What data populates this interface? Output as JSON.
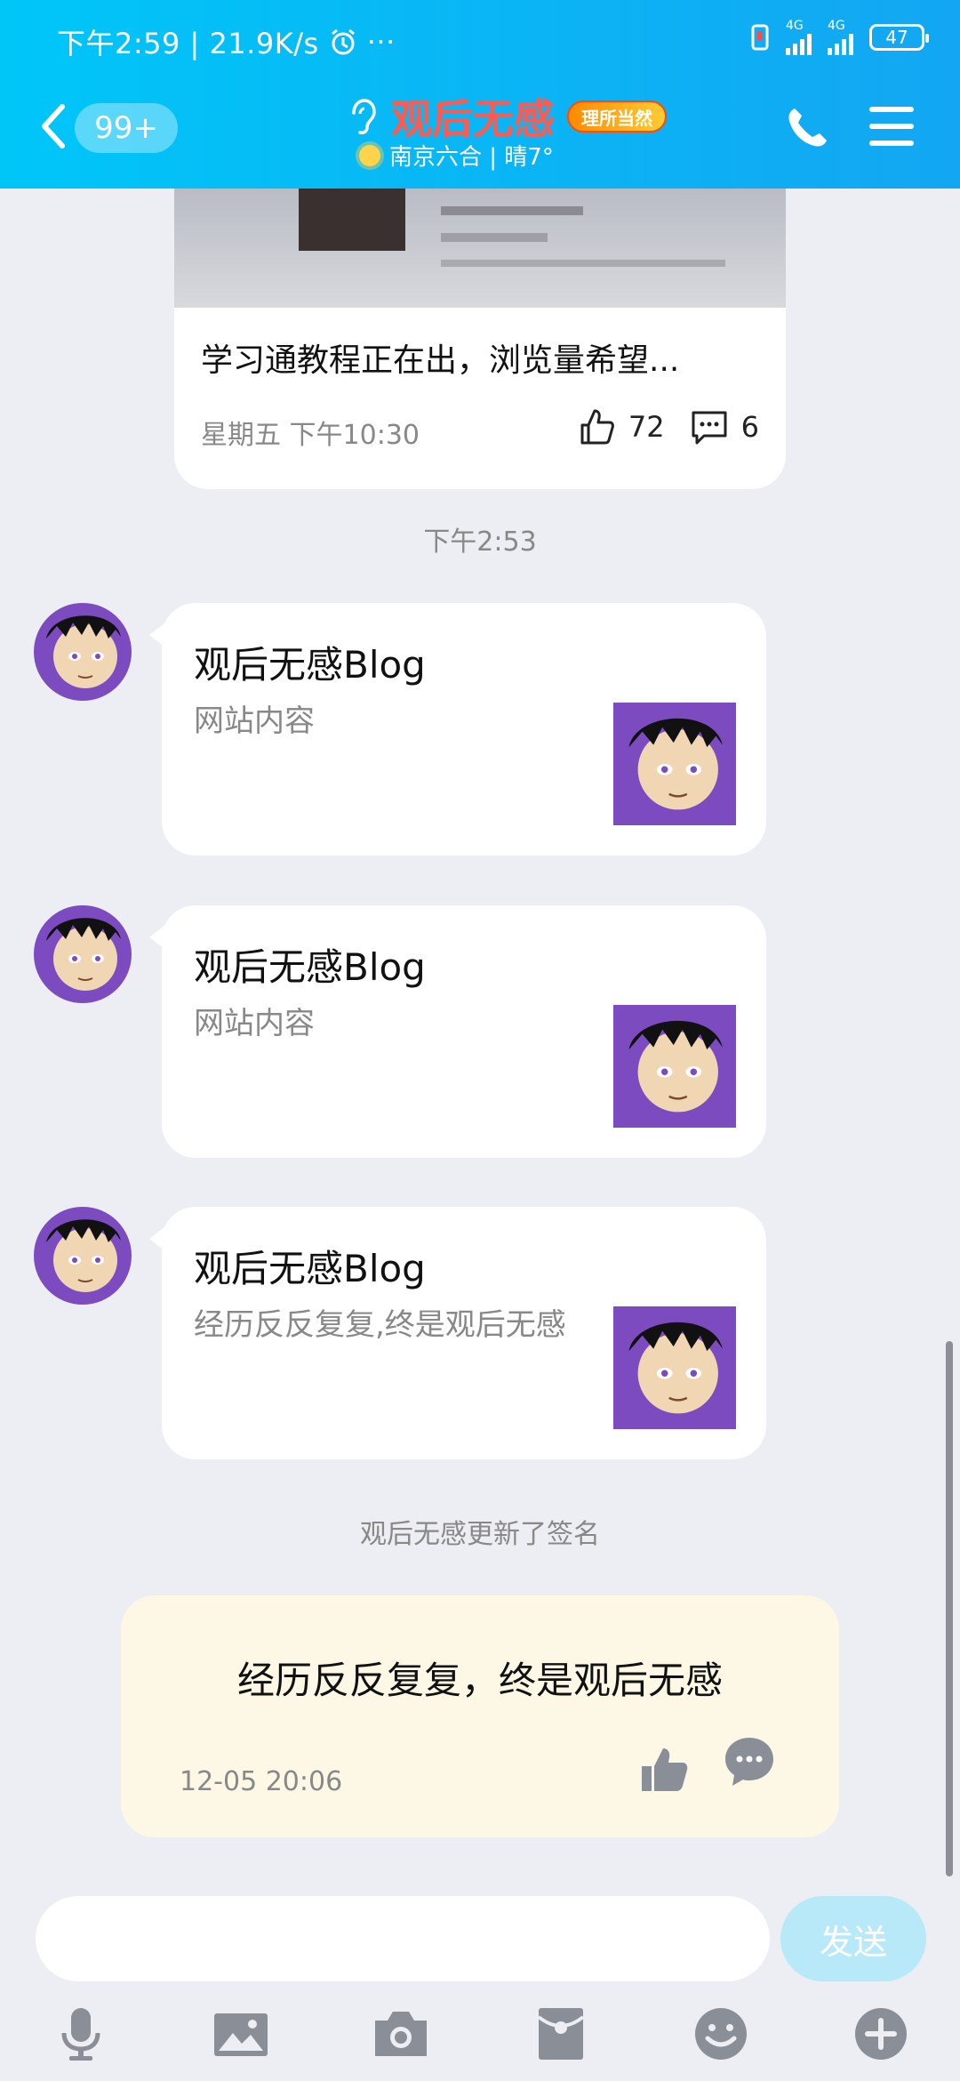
{
  "status_bar": {
    "time_speed": "下午2:59 | 21.9K/s",
    "more": "···",
    "net1": "4G",
    "net2": "4G",
    "battery": "47"
  },
  "header": {
    "badge": "99+",
    "title": "观后无感",
    "vip_badge": "理所当然",
    "subtitle": "南京六合 | 晴7°"
  },
  "shared_post": {
    "title": "学习通教程正在出，浏览量希望...",
    "time": "星期五 下午10:30",
    "likes": "72",
    "comments": "6"
  },
  "timestamp": "下午2:53",
  "messages": [
    {
      "title": "观后无感Blog",
      "desc": "网站内容"
    },
    {
      "title": "观后无感Blog",
      "desc": "网站内容"
    },
    {
      "title": "观后无感Blog",
      "desc": "经历反反复复,终是观后无感"
    }
  ],
  "system_notice": "观后无感更新了签名",
  "signature": {
    "text": "经历反反复复，终是观后无感",
    "time": "12-05 20:06"
  },
  "input": {
    "send_label": "发送"
  },
  "toolbar_icons": [
    "microphone-icon",
    "image-icon",
    "camera-icon",
    "red-packet-icon",
    "emoji-icon",
    "plus-icon"
  ],
  "colors": {
    "header_start": "#00c6f8",
    "header_end": "#13a6f2",
    "title_red": "#ff5a50",
    "signature_bg": "#fdf8e6",
    "send_bg": "#b7e9f8"
  }
}
